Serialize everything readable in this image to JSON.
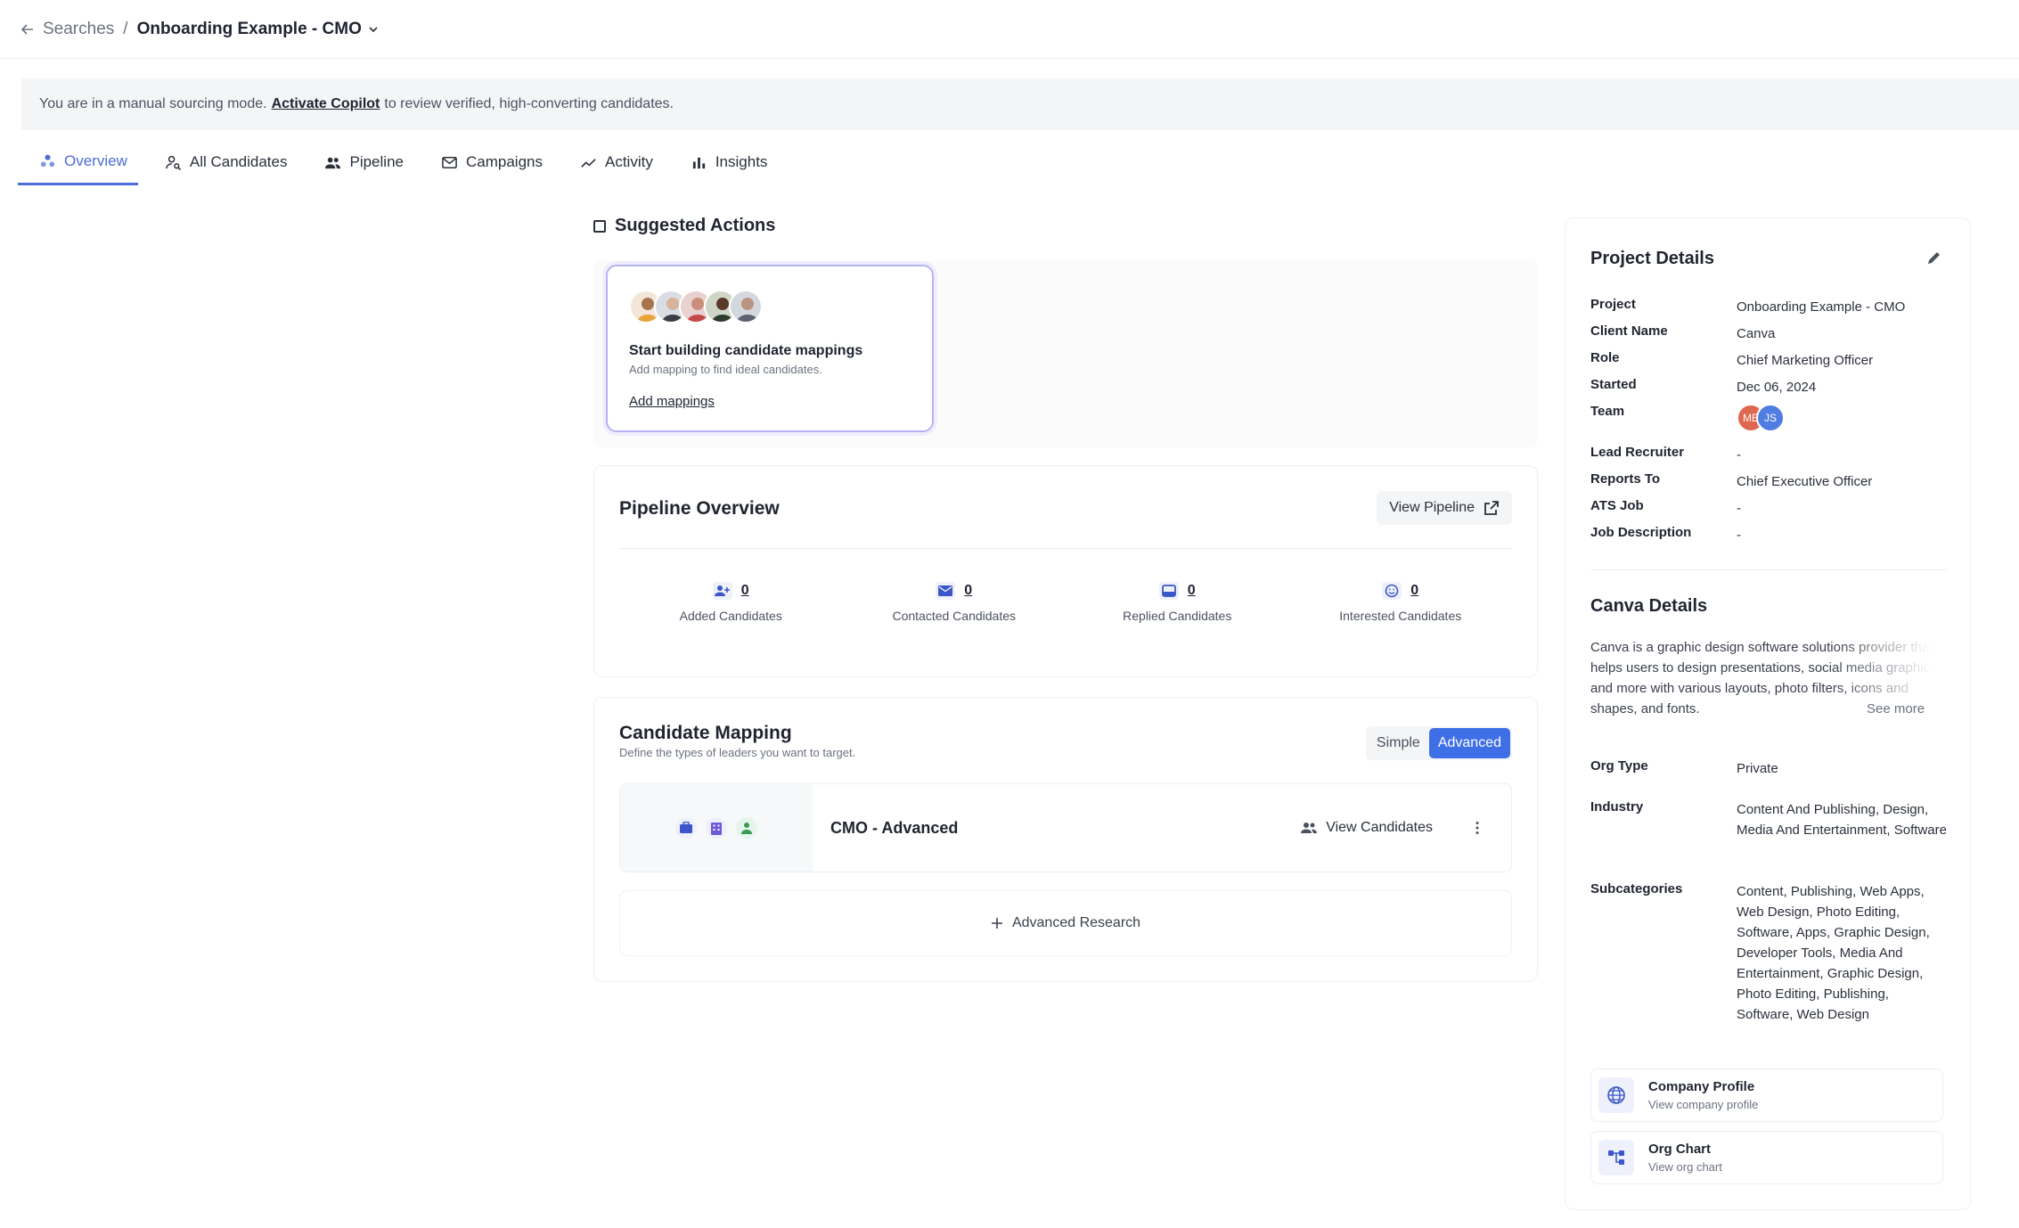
{
  "breadcrumb": {
    "parent": "Searches",
    "separator": "/",
    "current": "Onboarding Example - CMO"
  },
  "banner": {
    "prefix": "You are in a manual sourcing mode.",
    "link": "Activate Copilot",
    "suffix": "to review verified, high-converting candidates."
  },
  "tabs": [
    {
      "label": "Overview",
      "icon": "overview-icon",
      "active": true
    },
    {
      "label": "All Candidates",
      "icon": "person-search-icon"
    },
    {
      "label": "Pipeline",
      "icon": "people-icon"
    },
    {
      "label": "Campaigns",
      "icon": "mail-icon"
    },
    {
      "label": "Activity",
      "icon": "trend-icon"
    },
    {
      "label": "Insights",
      "icon": "bar-chart-icon"
    }
  ],
  "suggested": {
    "heading": "Suggested Actions",
    "card_title": "Start building candidate mappings",
    "card_sub": "Add mapping to find ideal candidates.",
    "card_link": "Add mappings"
  },
  "pipeline": {
    "title": "Pipeline Overview",
    "view_button": "View Pipeline",
    "stats": [
      {
        "value": "0",
        "label": "Added Candidates",
        "icon": "add-people-icon"
      },
      {
        "value": "0",
        "label": "Contacted Candidates",
        "icon": "envelope-icon"
      },
      {
        "value": "0",
        "label": "Replied Candidates",
        "icon": "inbox-icon"
      },
      {
        "value": "0",
        "label": "Interested Candidates",
        "icon": "smiley-icon"
      }
    ]
  },
  "mapping": {
    "title": "Candidate Mapping",
    "subtitle": "Define the types of leaders you want to target.",
    "toggle_simple": "Simple",
    "toggle_advanced": "Advanced",
    "row_name": "CMO - Advanced",
    "view_candidates": "View Candidates",
    "advanced_research": "Advanced Research"
  },
  "project": {
    "title": "Project Details",
    "rows": [
      {
        "key": "Project",
        "value": "Onboarding Example - CMO"
      },
      {
        "key": "Client Name",
        "value": "Canva"
      },
      {
        "key": "Role",
        "value": "Chief Marketing Officer"
      },
      {
        "key": "Started",
        "value": "Dec 06, 2024"
      },
      {
        "key": "Team",
        "value": ""
      },
      {
        "key": "Lead Recruiter",
        "value": "-"
      },
      {
        "key": "Reports To",
        "value": "Chief Executive Officer"
      },
      {
        "key": "ATS Job",
        "value": "-"
      },
      {
        "key": "Job Description",
        "value": "-"
      }
    ],
    "team": [
      {
        "initials": "ME",
        "color": "#e0674f"
      },
      {
        "initials": "JS",
        "color": "#4f7ee0"
      }
    ]
  },
  "company": {
    "title": "Canva Details",
    "about": "Canva is a graphic design software solutions provider that helps users to design presentations, social media graphics, and more with various layouts, photo filters, icons and shapes, and fonts.",
    "see_more": "See more",
    "rows": [
      {
        "key": "Org Type",
        "value": "Private"
      },
      {
        "key": "Industry",
        "value": "Content And Publishing, Design, Media And Entertainment, Software"
      },
      {
        "key": "Subcategories",
        "value": "Content, Publishing, Web Apps, Web Design, Photo Editing, Software, Apps, Graphic Design, Developer Tools, Media And Entertainment, Graphic Design, Photo Editing, Publishing, Software, Web Design"
      }
    ],
    "links": [
      {
        "title": "Company Profile",
        "sub": "View company profile",
        "icon": "globe-icon"
      },
      {
        "title": "Org Chart",
        "sub": "View org chart",
        "icon": "org-chart-icon"
      }
    ]
  },
  "colors": {
    "accent": "#4f6bd6",
    "toggle_on": "#3f6fe6",
    "card_border": "#b6b3f2"
  }
}
